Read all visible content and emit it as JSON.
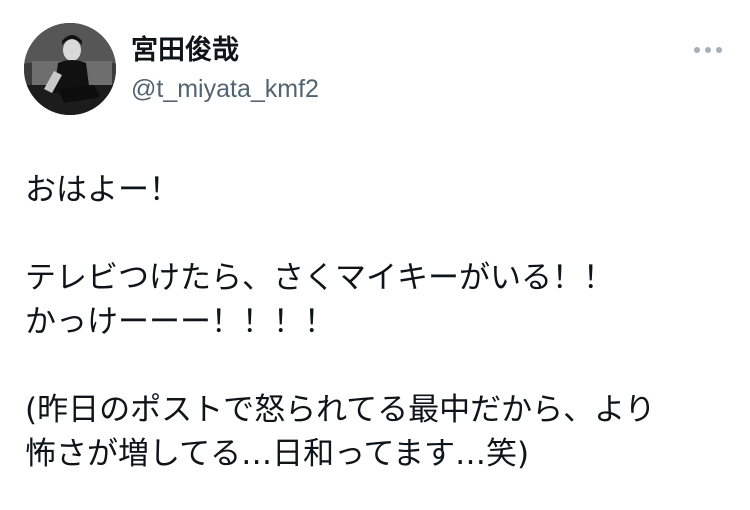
{
  "user": {
    "display_name": "宮田俊哉",
    "handle": "@t_miyata_kmf2",
    "avatar_icon": "profile-photo-icon"
  },
  "more_menu": {
    "icon": "more-horizontal-icon"
  },
  "tweet": {
    "lines": [
      "おはよー！",
      "",
      "テレビつけたら、さくマイキーがいる！！",
      "かっけーーー！！！！",
      "",
      "(昨日のポストで怒られてる最中だから、より",
      "怖さが増してる…日和ってます…笑)"
    ]
  },
  "colors": {
    "primary_text": "#0f1419",
    "secondary_text": "#536471",
    "background": "#ffffff"
  }
}
